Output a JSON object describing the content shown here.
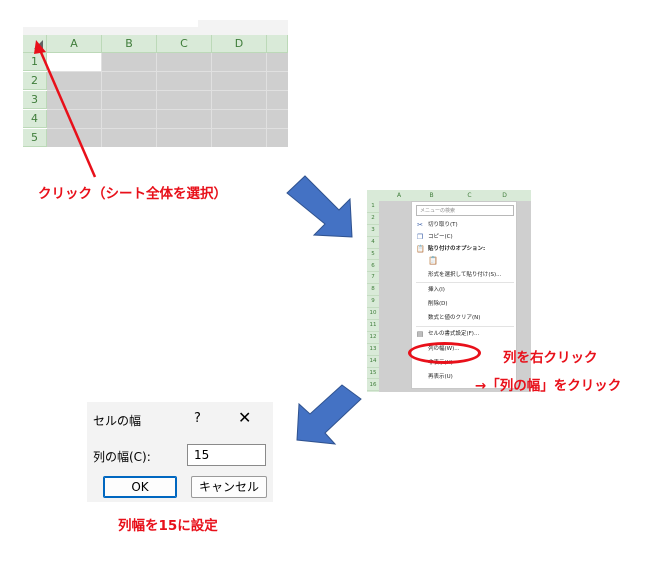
{
  "colors": {
    "annotation_red": "#e8101a",
    "arrow_blue": "#4472c4",
    "header_green": "#d9ead8",
    "header_text_green": "#3f7d3a",
    "selected_gray": "#cfcfcf"
  },
  "sheet": {
    "columns": [
      "A",
      "B",
      "C",
      "D"
    ],
    "rows": [
      "1",
      "2",
      "3",
      "4",
      "5"
    ]
  },
  "step1": {
    "caption": "クリック（シート全体を選択）"
  },
  "context_sheet": {
    "columns": [
      "A",
      "B",
      "C",
      "D"
    ],
    "rows": [
      "1",
      "2",
      "3",
      "4",
      "5",
      "6",
      "7",
      "8",
      "9",
      "10",
      "11",
      "12",
      "13",
      "14",
      "15",
      "16"
    ]
  },
  "context_menu": {
    "search_placeholder": "メニューの検索",
    "items": [
      {
        "label": "切り取り(T)",
        "icon": "scissors-icon"
      },
      {
        "label": "コピー(C)",
        "icon": "copy-icon"
      },
      {
        "label": "貼り付けのオプション:",
        "icon": "paste-icon"
      },
      {
        "label": "形式を選択して貼り付け(S)..."
      },
      {
        "label": "挿入(I)"
      },
      {
        "label": "削除(D)"
      },
      {
        "label": "数式と値のクリア(N)"
      },
      {
        "label": "セルの書式設定(F)...",
        "icon": "format-cells-icon"
      },
      {
        "label": "列の幅(W)..."
      },
      {
        "label": "非表示(H)"
      },
      {
        "label": "再表示(U)"
      }
    ]
  },
  "step2": {
    "caption_line1": "列を右クリック",
    "caption_line2": "→「列の幅」をクリック"
  },
  "dialog": {
    "title": "セルの幅",
    "help": "?",
    "close": "✕",
    "field_label": "列の幅(C):",
    "field_value": "15",
    "ok_label": "OK",
    "cancel_label": "キャンセル"
  },
  "step3": {
    "caption": "列幅を15に設定"
  }
}
